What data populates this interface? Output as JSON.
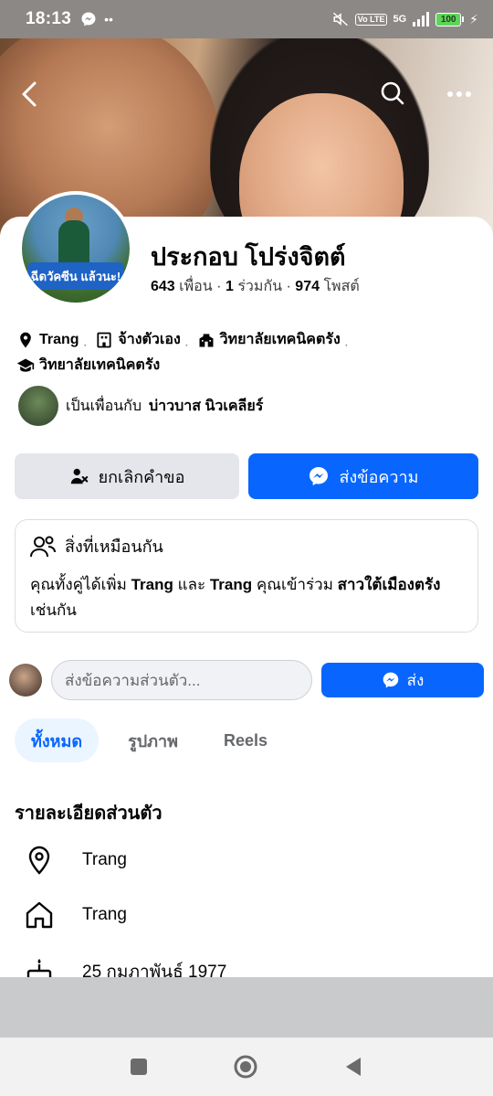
{
  "status_bar": {
    "time": "18:13",
    "volte": "Vo LTE",
    "network": "5G",
    "battery": "100"
  },
  "profile": {
    "name": "ประกอบ โปร่งจิตต์",
    "friends_count": "643",
    "friends_label": "เพื่อน",
    "mutual_count": "1",
    "mutual_label": "ร่วมกัน",
    "posts_count": "974",
    "posts_label": "โพสต์",
    "avatar_text": "ฉีดวัคซีน แล้วนะ!"
  },
  "intro": {
    "location": "Trang",
    "work": "จ้างตัวเอง",
    "education1": "วิทยาลัยเทคนิคตรัง",
    "education2": "วิทยาลัยเทคนิคตรัง"
  },
  "mutual_friend": {
    "prefix": "เป็นเพื่อนกับ",
    "name": "บ่าวบาส นิวเคลียร์"
  },
  "actions": {
    "cancel_request": "ยกเลิกคำขอ",
    "send_message": "ส่งข้อความ"
  },
  "in_common": {
    "title": "สิ่งที่เหมือนกัน",
    "text_1": "คุณทั้งคู่ได้เพิ่ม",
    "place_1": "Trang",
    "and": "และ",
    "place_2": "Trang",
    "text_2": "คุณเข้าร่วม",
    "group": "สาวใต้เมืองตรัง",
    "text_3": "เช่นกัน"
  },
  "message_bar": {
    "placeholder": "ส่งข้อความส่วนตัว...",
    "send_label": "ส่ง"
  },
  "tabs": [
    {
      "label": "ทั้งหมด",
      "active": true
    },
    {
      "label": "รูปภาพ",
      "active": false
    },
    {
      "label": "Reels",
      "active": false
    }
  ],
  "details": {
    "title": "รายละเอียดส่วนตัว",
    "current_city": "Trang",
    "hometown": "Trang",
    "birthday": "25 กุมภาพันธ์ 1977"
  },
  "colors": {
    "accent": "#0866ff",
    "button_grey": "#e4e6eb",
    "tab_active_bg": "#ebf5ff"
  },
  "icons": [
    "back-arrow-icon",
    "search-icon",
    "more-icon",
    "location-icon",
    "building-icon",
    "school-icon",
    "graduation-icon",
    "person-cancel-icon",
    "messenger-icon",
    "people-icon",
    "home-icon",
    "cake-icon"
  ]
}
